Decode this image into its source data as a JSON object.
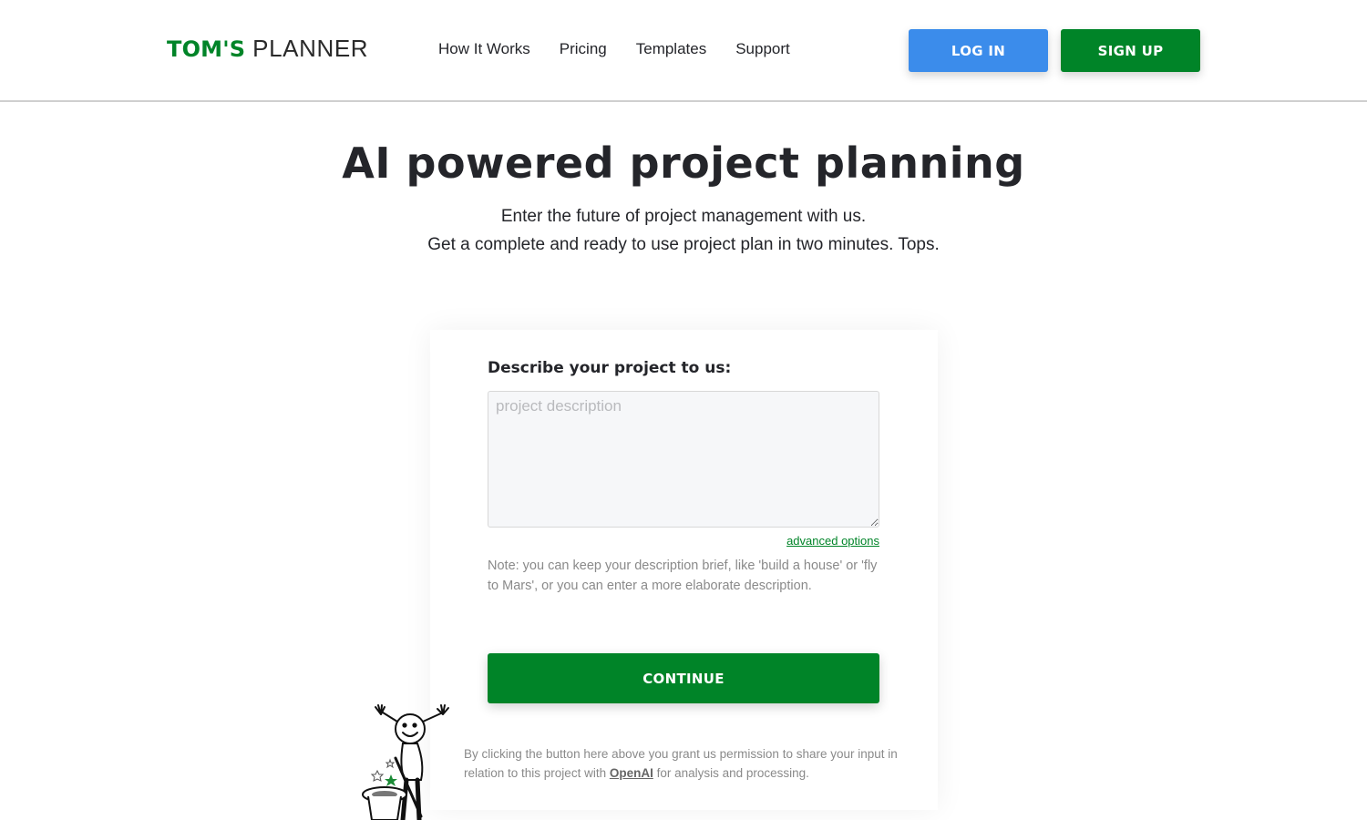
{
  "header": {
    "logo_bold": "TOM'S",
    "logo_light": "PLANNER",
    "nav": [
      {
        "label": "How It Works"
      },
      {
        "label": "Pricing"
      },
      {
        "label": "Templates"
      },
      {
        "label": "Support"
      }
    ],
    "login_label": "LOG IN",
    "signup_label": "SIGN UP"
  },
  "hero": {
    "title": "AI powered project planning",
    "subtitle_line1": "Enter the future of project management with us.",
    "subtitle_line2": "Get a complete and ready to use project plan in two minutes. Tops."
  },
  "form": {
    "label": "Describe your project to us:",
    "textarea_value": "",
    "textarea_placeholder": "project description",
    "advanced_options_label": "advanced options",
    "note": "Note: you can keep your description brief, like 'build a house' or 'fly to Mars', or you can enter a more elaborate description.",
    "continue_label": "CONTINUE",
    "consent_before": "By clicking the button here above you grant us permission to share your input in relation to this project with ",
    "consent_link": "OpenAI",
    "consent_after": " for analysis and processing."
  },
  "mascot": {
    "icon": "magician-stick-figure-icon"
  },
  "colors": {
    "brand_green": "#008428",
    "login_blue": "#3b8ceb",
    "text_dark": "#24252a",
    "text_muted": "#8a8a8a"
  }
}
